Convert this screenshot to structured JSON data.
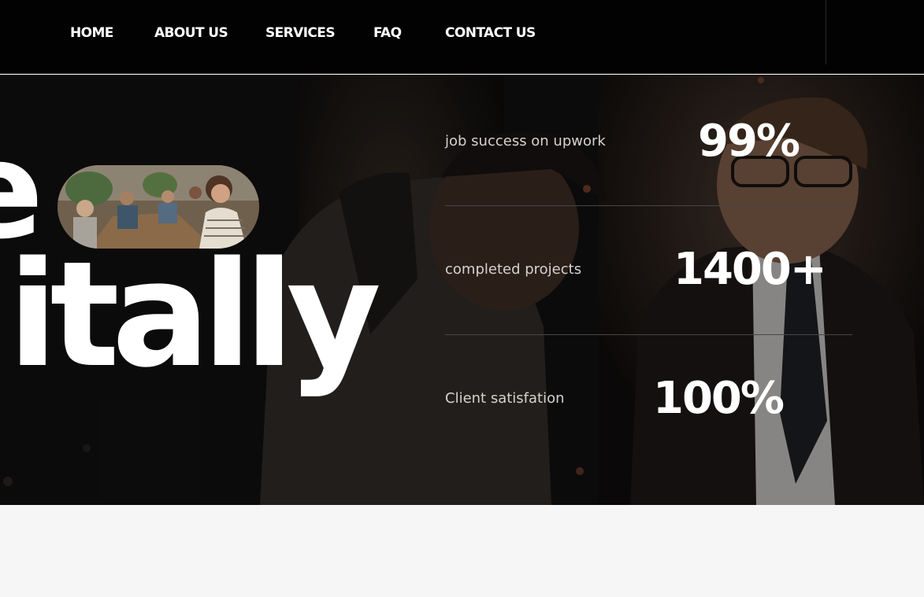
{
  "nav": {
    "items": [
      {
        "label": "HOME"
      },
      {
        "label": "ABOUT US"
      },
      {
        "label": "SERVICES"
      },
      {
        "label": "FAQ"
      },
      {
        "label": "CONTACT US"
      }
    ]
  },
  "hero": {
    "headline_fragment": "itally",
    "headline_letter": "e",
    "stats": [
      {
        "label": "job success on upwork",
        "value": "99%"
      },
      {
        "label": "completed projects",
        "value": "1400+"
      },
      {
        "label": "Client satisfation",
        "value": "100%"
      }
    ]
  },
  "colors": {
    "header_bg": "#020202",
    "hero_overlay": "#141210",
    "text_primary": "#ffffff",
    "page_bg": "#f6f6f6"
  }
}
